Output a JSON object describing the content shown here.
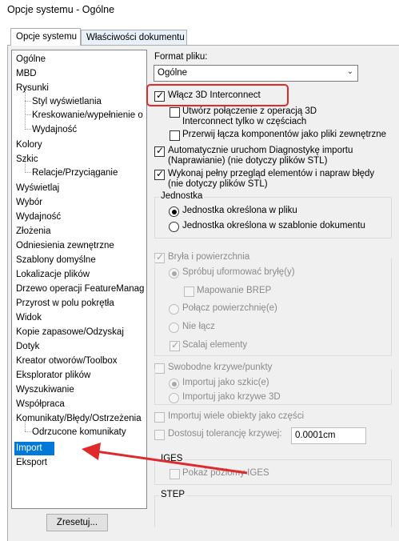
{
  "window": {
    "title": "Opcje systemu - Ogólne"
  },
  "tabs": [
    {
      "label": "Opcje systemu",
      "active": true
    },
    {
      "label": "Właściwości dokumentu",
      "active": false
    }
  ],
  "tree": {
    "items": [
      {
        "label": "Ogólne",
        "level": 0
      },
      {
        "label": "MBD",
        "level": 0
      },
      {
        "label": "Rysunki",
        "level": 0
      },
      {
        "label": "Styl wyświetlania",
        "level": 1
      },
      {
        "label": "Kreskowanie/wypełnienie o",
        "level": 1
      },
      {
        "label": "Wydajność",
        "level": 1
      },
      {
        "label": "Kolory",
        "level": 0
      },
      {
        "label": "Szkic",
        "level": 0
      },
      {
        "label": "Relacje/Przyciąganie",
        "level": 1
      },
      {
        "label": "Wyświetlaj",
        "level": 0
      },
      {
        "label": "Wybór",
        "level": 0
      },
      {
        "label": "Wydajność",
        "level": 0
      },
      {
        "label": "Złożenia",
        "level": 0
      },
      {
        "label": "Odniesienia zewnętrzne",
        "level": 0
      },
      {
        "label": "Szablony domyślne",
        "level": 0
      },
      {
        "label": "Lokalizacje plików",
        "level": 0
      },
      {
        "label": "Drzewo operacji FeatureManag",
        "level": 0
      },
      {
        "label": "Przyrost w polu pokrętła",
        "level": 0
      },
      {
        "label": "Widok",
        "level": 0
      },
      {
        "label": "Kopie zapasowe/Odzyskaj",
        "level": 0
      },
      {
        "label": "Dotyk",
        "level": 0
      },
      {
        "label": "Kreator otworów/Toolbox",
        "level": 0
      },
      {
        "label": "Eksplorator plików",
        "level": 0
      },
      {
        "label": "Wyszukiwanie",
        "level": 0
      },
      {
        "label": "Współpraca",
        "level": 0
      },
      {
        "label": "Komunikaty/Błędy/Ostrzeżenia",
        "level": 0
      },
      {
        "label": "Odrzucone komunikaty",
        "level": 1
      },
      {
        "label": "Import",
        "level": 0,
        "selected": true
      },
      {
        "label": "Eksport",
        "level": 0
      }
    ]
  },
  "reset_button": {
    "label": "Zresetuj..."
  },
  "format": {
    "label": "Format pliku:",
    "value": "Ogólne"
  },
  "options": {
    "enable_3d_interconnect": {
      "label": "Włącz 3D Interconnect",
      "checked": true
    },
    "create_link_line1": "Utwórz połączenie z operacją 3D",
    "create_link_line2": "Interconnect tylko w częściach",
    "create_link_checked": false,
    "break_link": {
      "label": "Przerwij łącza komponentów jako pliki zewnętrzne",
      "checked": false
    },
    "auto_diag_line1": "Automatycznie uruchom Diagnostykę importu",
    "auto_diag_line2": "(Naprawianie) (nie dotyczy plików STL)",
    "auto_diag_checked": true,
    "full_check_line1": "Wykonaj pełny przegląd elementów i napraw błędy",
    "full_check_line2": "(nie dotyczy plików STL)",
    "full_check_checked": true
  },
  "unit_group": {
    "title": "Jednostka",
    "opt_file": "Jednostka określona w pliku",
    "opt_template": "Jednostka określona w szablonie dokumentu"
  },
  "solid_group": {
    "title": "Bryła i powierzchnia",
    "try_solid": "Spróbuj uformować bryłę(y)",
    "brep": "Mapowanie BREP",
    "knit": "Połącz powierzchnię(e)",
    "no_knit": "Nie łącz",
    "merge": "Scalaj elementy"
  },
  "curves_group": {
    "title": "Swobodne krzywe/punkty",
    "as_sketch": "Importuj jako szkic(e)",
    "as_3d": "Importuj jako krzywe 3D"
  },
  "multi_body": {
    "label": "Importuj wiele obiekty jako części"
  },
  "tolerance": {
    "label": "Dostosuj tolerancję krzywej:",
    "value": "0.0001cm"
  },
  "iges_group": {
    "title": "IGES",
    "show_levels": "Pokaż poziomy IGES"
  },
  "step_group": {
    "title": "STEP"
  },
  "colors": {
    "highlight": "#e0292b",
    "selection": "#0078d7"
  }
}
